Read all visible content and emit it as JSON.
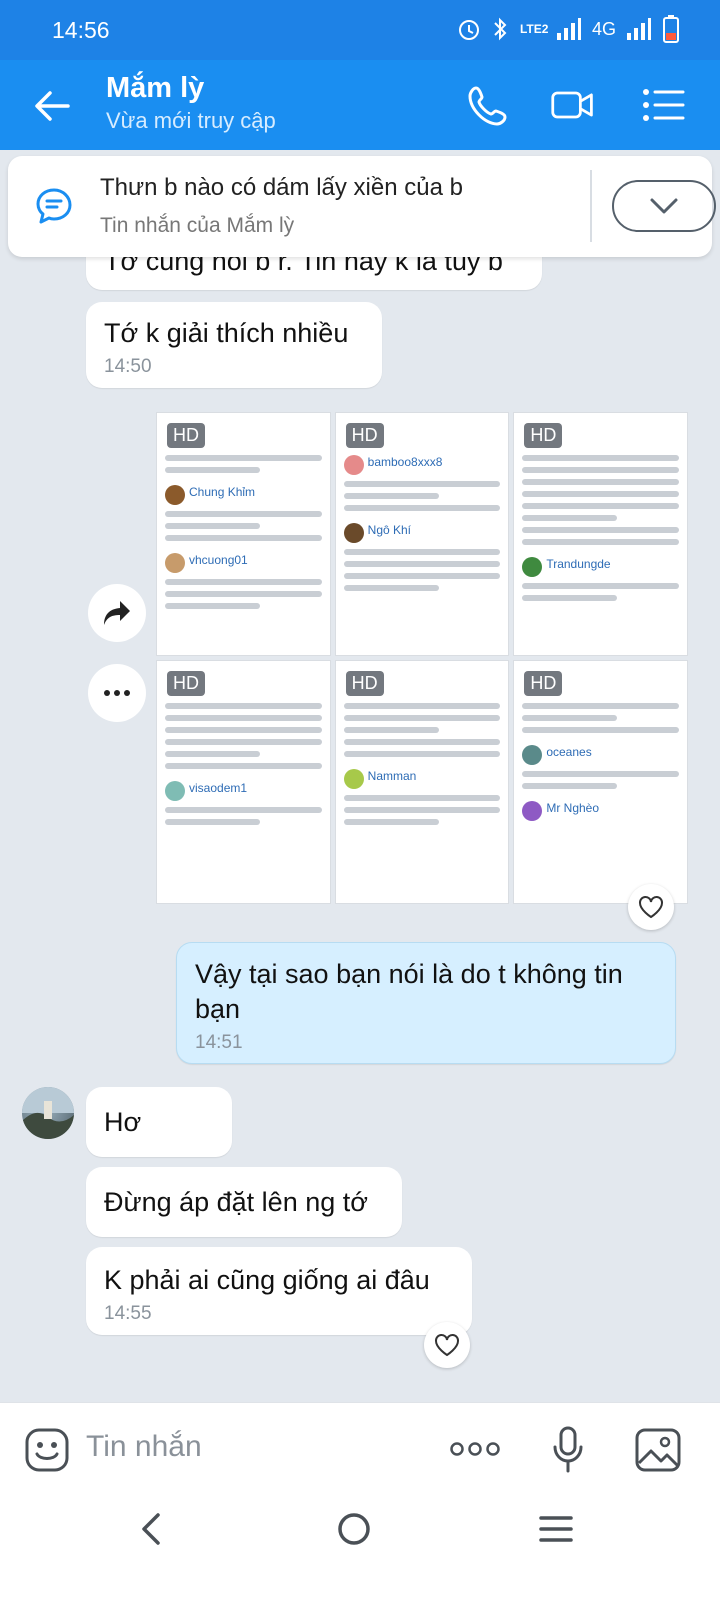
{
  "status_bar": {
    "time": "14:56",
    "network": "4G",
    "volte": "LTE2"
  },
  "header": {
    "title": "Mắm lỳ",
    "subtitle": "Vừa mới truy cập"
  },
  "pinned": {
    "text": "Thưn b nào có dám lấy xiền của b",
    "sub": "Tin nhắn của Mắm lỳ"
  },
  "messages": [
    {
      "text": "Tớ cũng nói b r. Tin hay k là tùy b",
      "time": ""
    },
    {
      "text": "Tớ k giải thích nhiều",
      "time": "14:50"
    },
    {
      "text": "Vậy tại sao bạn nói là do t không tin bạn",
      "time": "14:51"
    },
    {
      "text": "Hơ",
      "time": ""
    },
    {
      "text": "Đừng áp đặt lên ng tớ",
      "time": ""
    },
    {
      "text": "K phải ai cũng giống ai đâu",
      "time": "14:55"
    }
  ],
  "photos": [
    {
      "hd": "HD",
      "name1": "Chung Khỉm",
      "name2": "vhcuong01"
    },
    {
      "hd": "HD",
      "name1": "bamboo8xxx8",
      "name2": "Ngô Khí"
    },
    {
      "hd": "HD",
      "name1": "Trandungde",
      "name2": ""
    },
    {
      "hd": "HD",
      "name1": "visaodem1",
      "name2": ""
    },
    {
      "hd": "HD",
      "name1": "Namman",
      "name2": ""
    },
    {
      "hd": "HD",
      "name1": "oceanes",
      "name2": "Mr Nghèo"
    }
  ],
  "input": {
    "placeholder": "Tin nhắn"
  },
  "colors": {
    "header": "#1a8ef1",
    "statusbar": "#1e82e6",
    "mine": "#d6efff"
  }
}
